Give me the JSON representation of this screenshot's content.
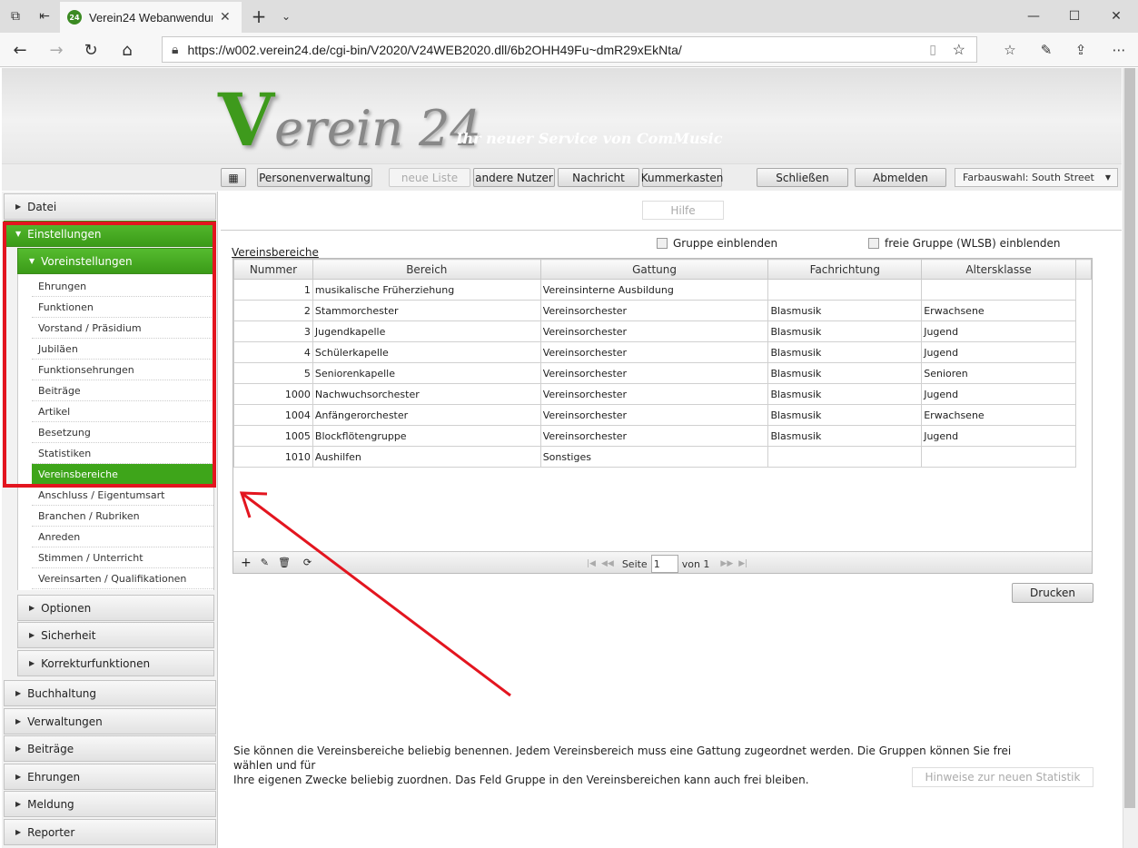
{
  "browser": {
    "tab_title": "Verein24 Webanwendur",
    "favicon_text": "24",
    "url": "https://w002.verein24.de/cgi-bin/V2020/V24WEB2020.dll/6b2OHH49Fu~dmR29xEkNta/"
  },
  "banner": {
    "logo_v": "V",
    "logo_rest": "erein 24",
    "slogan": "Ihr neuer Service von ComMusic"
  },
  "toolbar": {
    "menu_icon": "menu-icon",
    "personenverwaltung": "Personenverwaltung",
    "neue_liste": "neue Liste",
    "andere_nutzer": "andere Nutzer",
    "nachricht": "Nachricht",
    "kummerkasten": "Kummerkasten",
    "schliessen": "Schließen",
    "abmelden": "Abmelden",
    "farbauswahl": "Farbauswahl: South Street"
  },
  "sidebar": {
    "datei": "Datei",
    "einstellungen": "Einstellungen",
    "voreinstellungen": "Voreinstellungen",
    "items": [
      "Ehrungen",
      "Funktionen",
      "Vorstand / Präsidium",
      "Jubiläen",
      "Funktionsehrungen",
      "Beiträge",
      "Artikel",
      "Besetzung",
      "Statistiken",
      "Vereinsbereiche",
      "Anschluss / Eigentumsart",
      "Branchen / Rubriken",
      "Anreden",
      "Stimmen / Unterricht",
      "Vereinsarten / Qualifikationen"
    ],
    "active_item": "Vereinsbereiche",
    "sub_sections": [
      "Optionen",
      "Sicherheit",
      "Korrekturfunktionen"
    ],
    "sections": [
      "Buchhaltung",
      "Verwaltungen",
      "Beiträge",
      "Ehrungen",
      "Meldung",
      "Reporter"
    ]
  },
  "main": {
    "hilfe": "Hilfe",
    "section_label": "Vereinsbereiche",
    "chk_gruppe": "Gruppe einblenden",
    "chk_freie_gruppe": "freie Gruppe (WLSB) einblenden",
    "columns": [
      "Nummer",
      "Bereich",
      "Gattung",
      "Fachrichtung",
      "Altersklasse"
    ],
    "rows": [
      [
        "1",
        "musikalische Früherziehung",
        "Vereinsinterne Ausbildung",
        "",
        ""
      ],
      [
        "2",
        "Stammorchester",
        "Vereinsorchester",
        "Blasmusik",
        "Erwachsene"
      ],
      [
        "3",
        "Jugendkapelle",
        "Vereinsorchester",
        "Blasmusik",
        "Jugend"
      ],
      [
        "4",
        "Schülerkapelle",
        "Vereinsorchester",
        "Blasmusik",
        "Jugend"
      ],
      [
        "5",
        "Seniorenkapelle",
        "Vereinsorchester",
        "Blasmusik",
        "Senioren"
      ],
      [
        "1000",
        "Nachwuchsorchester",
        "Vereinsorchester",
        "Blasmusik",
        "Jugend"
      ],
      [
        "1004",
        "Anfängerorchester",
        "Vereinsorchester",
        "Blasmusik",
        "Erwachsene"
      ],
      [
        "1005",
        "Blockflötengruppe",
        "Vereinsorchester",
        "Blasmusik",
        "Jugend"
      ],
      [
        "1010",
        "Aushilfen",
        "Sonstiges",
        "",
        ""
      ]
    ],
    "pager": {
      "seite": "Seite",
      "page_value": "1",
      "von": "von 1"
    },
    "drucken": "Drucken",
    "info_line1": "Sie können die Vereinsbereiche beliebig benennen. Jedem Vereinsbereich muss eine Gattung zugeordnet werden. Die Gruppen können Sie frei wählen und für",
    "info_line2": "Ihre eigenen Zwecke beliebig zuordnen. Das Feld Gruppe in den Vereinsbereichen kann auch frei bleiben.",
    "hinweise": "Hinweise zur neuen Statistik"
  },
  "annotation": {
    "color": "#e3151f"
  }
}
